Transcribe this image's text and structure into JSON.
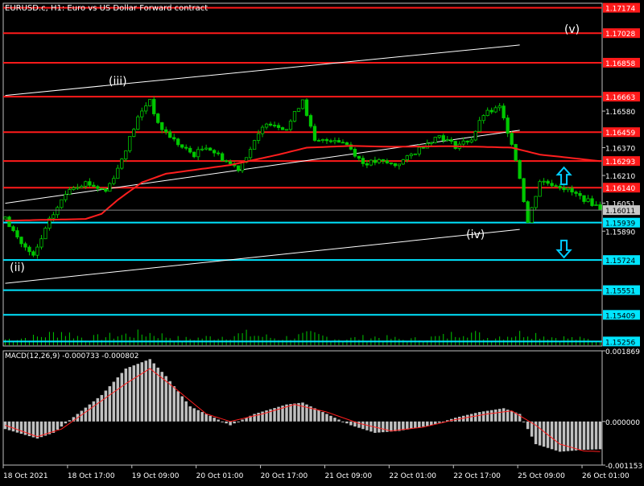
{
  "chart_title": "EURUSD.c, H1:  Euro vs US Dollar Forward contract",
  "colors": {
    "background": "#000000",
    "frame": "#c0c0c0",
    "grid": "#3a3a3a",
    "candle": "#00c800",
    "ma": "#ff1e1e",
    "resistance": "#ff1a1a",
    "support": "#00e5ff",
    "trendline": "#ffffff",
    "macd_hist": "#c0c0c0",
    "macd_signal": "#ff1e1e",
    "current_price_bg": "#c8c8c8",
    "arrow": "#00ccff"
  },
  "chart_data": [
    {
      "type": "candlestick",
      "name": "price",
      "ylim": [
        1.1523,
        1.172
      ],
      "y_ticks": [
        "1.16580",
        "1.16370",
        "1.16210",
        "1.16051",
        "1.15890"
      ],
      "x_ticks": [
        "18 Oct 2021",
        "18 Oct 17:00",
        "19 Oct 09:00",
        "20 Oct 01:00",
        "20 Oct 17:00",
        "21 Oct 09:00",
        "22 Oct 01:00",
        "22 Oct 17:00",
        "25 Oct 09:00",
        "26 Oct 01:00"
      ],
      "bars_per_tick": 16,
      "bar_count": 149,
      "close_path": [
        [
          0,
          1.1596
        ],
        [
          4,
          1.1582
        ],
        [
          7,
          1.1574
        ],
        [
          11,
          1.1595
        ],
        [
          16,
          1.1614
        ],
        [
          20,
          1.1617
        ],
        [
          25,
          1.1612
        ],
        [
          28,
          1.1625
        ],
        [
          33,
          1.1654
        ],
        [
          36,
          1.1665
        ],
        [
          38,
          1.165
        ],
        [
          44,
          1.1637
        ],
        [
          47,
          1.1633
        ],
        [
          50,
          1.1638
        ],
        [
          55,
          1.1629
        ],
        [
          58,
          1.1625
        ],
        [
          62,
          1.164
        ],
        [
          65,
          1.1652
        ],
        [
          70,
          1.1648
        ],
        [
          74,
          1.1665
        ],
        [
          77,
          1.164
        ],
        [
          82,
          1.1642
        ],
        [
          85,
          1.1639
        ],
        [
          89,
          1.1628
        ],
        [
          93,
          1.1629
        ],
        [
          97,
          1.1627
        ],
        [
          100,
          1.1631
        ],
        [
          105,
          1.164
        ],
        [
          108,
          1.1644
        ],
        [
          112,
          1.1638
        ],
        [
          116,
          1.1642
        ],
        [
          119,
          1.1656
        ],
        [
          123,
          1.166
        ],
        [
          126,
          1.164
        ],
        [
          128,
          1.162
        ],
        [
          130,
          1.1594
        ],
        [
          133,
          1.1618
        ],
        [
          138,
          1.1615
        ],
        [
          142,
          1.161
        ],
        [
          146,
          1.1605
        ],
        [
          149,
          1.16011
        ]
      ],
      "ma_path": [
        [
          0,
          1.1595
        ],
        [
          20,
          1.1596
        ],
        [
          24,
          1.1599
        ],
        [
          28,
          1.1607
        ],
        [
          34,
          1.1617
        ],
        [
          40,
          1.1622
        ],
        [
          56,
          1.1627
        ],
        [
          68,
          1.1633
        ],
        [
          75,
          1.1637
        ],
        [
          86,
          1.1638
        ],
        [
          96,
          1.16375
        ],
        [
          110,
          1.16378
        ],
        [
          118,
          1.16375
        ],
        [
          126,
          1.1637
        ],
        [
          133,
          1.1633
        ],
        [
          149,
          1.1629
        ]
      ],
      "volume_path": [
        [
          0,
          0.4
        ],
        [
          8,
          0.55
        ],
        [
          14,
          0.9
        ],
        [
          20,
          0.45
        ],
        [
          28,
          0.65
        ],
        [
          36,
          0.8
        ],
        [
          44,
          0.4
        ],
        [
          52,
          0.55
        ],
        [
          60,
          0.75
        ],
        [
          68,
          0.45
        ],
        [
          76,
          0.7
        ],
        [
          84,
          0.4
        ],
        [
          92,
          0.55
        ],
        [
          100,
          0.35
        ],
        [
          110,
          0.6
        ],
        [
          114,
          1.0
        ],
        [
          120,
          0.5
        ],
        [
          126,
          0.7
        ],
        [
          130,
          0.85
        ],
        [
          136,
          0.55
        ],
        [
          149,
          0.3
        ]
      ],
      "horizontal_levels": [
        {
          "price": 1.17174,
          "label": "1.17174",
          "kind": "resistance"
        },
        {
          "price": 1.17028,
          "label": "1.17028",
          "kind": "resistance"
        },
        {
          "price": 1.16858,
          "label": "1.16858",
          "kind": "resistance"
        },
        {
          "price": 1.16663,
          "label": "1.16663",
          "kind": "resistance"
        },
        {
          "price": 1.16459,
          "label": "1.16459",
          "kind": "resistance"
        },
        {
          "price": 1.16293,
          "label": "1.16293",
          "kind": "resistance"
        },
        {
          "price": 1.1614,
          "label": "1.16140",
          "kind": "resistance"
        },
        {
          "price": 1.15939,
          "label": "1.15939",
          "kind": "support"
        },
        {
          "price": 1.15724,
          "label": "1.15724",
          "kind": "support"
        },
        {
          "price": 1.15551,
          "label": "1.15551",
          "kind": "support"
        },
        {
          "price": 1.15409,
          "label": "1.15409",
          "kind": "support"
        },
        {
          "price": 1.15256,
          "label": "1.15256",
          "kind": "support"
        }
      ],
      "current_price": {
        "price": 1.16011,
        "label": "1.16011"
      },
      "trendlines": [
        {
          "from": [
            0,
            1.1667
          ],
          "to": [
            128,
            1.1696
          ]
        },
        {
          "from": [
            0,
            1.1559
          ],
          "to": [
            128,
            1.159
          ]
        },
        {
          "from": [
            0,
            1.1605
          ],
          "to": [
            128,
            1.1647
          ]
        }
      ],
      "wave_labels": [
        {
          "text": "(ii)",
          "bar": 3,
          "price": 1.1566
        },
        {
          "text": "(iii)",
          "bar": 28,
          "price": 1.1673
        },
        {
          "text": "(iv)",
          "bar": 117,
          "price": 1.1585
        },
        {
          "text": "(v)",
          "bar": 141,
          "price": 1.1703
        }
      ],
      "arrows": [
        {
          "direction": "up",
          "bar": 139,
          "price": 1.16205
        },
        {
          "direction": "down",
          "bar": 139,
          "price": 1.1579
        }
      ]
    },
    {
      "type": "macd",
      "title": "MACD(12,26,9) -0.000733 -0.000802",
      "ylim": [
        -0.001153,
        0.001869
      ],
      "y_ticks": [
        "0.001869",
        "0.000000",
        "-0.001153"
      ],
      "hist_path": [
        [
          0,
          -0.0002
        ],
        [
          8,
          -0.00045
        ],
        [
          12,
          -0.0003
        ],
        [
          18,
          0.0002
        ],
        [
          24,
          0.0007
        ],
        [
          30,
          0.0014
        ],
        [
          36,
          0.00165
        ],
        [
          40,
          0.0012
        ],
        [
          46,
          0.0004
        ],
        [
          52,
          0.0001
        ],
        [
          56,
          -0.0001
        ],
        [
          62,
          0.0002
        ],
        [
          70,
          0.00045
        ],
        [
          74,
          0.0005
        ],
        [
          80,
          0.0002
        ],
        [
          86,
          -0.0001
        ],
        [
          92,
          -0.0003
        ],
        [
          98,
          -0.00025
        ],
        [
          106,
          -0.0001
        ],
        [
          112,
          0.0001
        ],
        [
          118,
          0.00025
        ],
        [
          124,
          0.00035
        ],
        [
          128,
          0.0002
        ],
        [
          132,
          -0.0006
        ],
        [
          138,
          -0.0008
        ],
        [
          144,
          -0.00075
        ],
        [
          149,
          -0.00073
        ]
      ],
      "signal_path": [
        [
          0,
          -0.0001
        ],
        [
          8,
          -0.0004
        ],
        [
          14,
          -0.0002
        ],
        [
          22,
          0.0004
        ],
        [
          30,
          0.001
        ],
        [
          36,
          0.0014
        ],
        [
          42,
          0.0009
        ],
        [
          50,
          0.0002
        ],
        [
          56,
          0.0
        ],
        [
          64,
          0.0002
        ],
        [
          72,
          0.00045
        ],
        [
          80,
          0.00025
        ],
        [
          88,
          -5e-05
        ],
        [
          96,
          -0.00025
        ],
        [
          104,
          -0.00015
        ],
        [
          112,
          5e-05
        ],
        [
          120,
          0.0002
        ],
        [
          126,
          0.00028
        ],
        [
          132,
          -0.0001
        ],
        [
          138,
          -0.0006
        ],
        [
          144,
          -0.00078
        ],
        [
          149,
          -0.0008
        ]
      ]
    }
  ]
}
